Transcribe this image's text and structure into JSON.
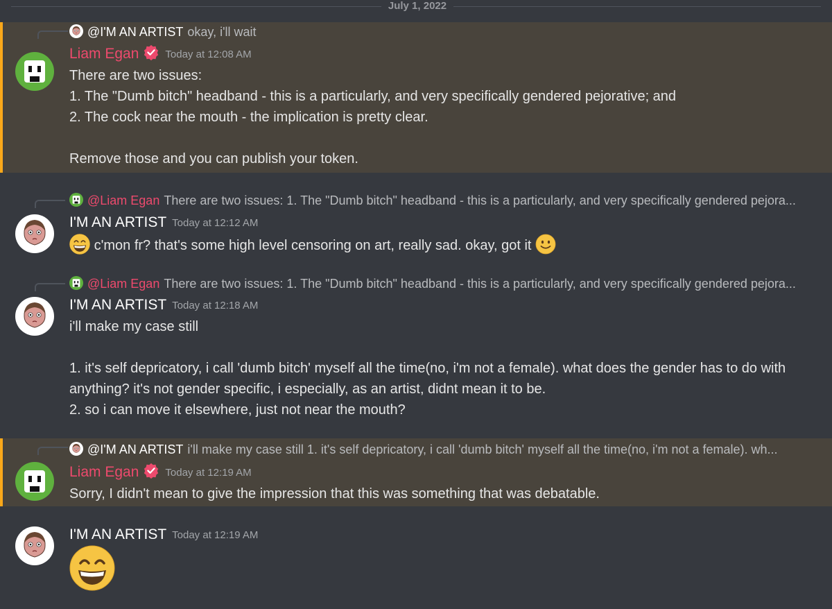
{
  "date_divider": "July 1, 2022",
  "messages": [
    {
      "reply": {
        "mention": "@I'M AN ARTIST",
        "preview": "okay, i'll wait"
      },
      "author": "Liam Egan",
      "timestamp": "Today at 12:08 AM",
      "lines": [
        "There are two issues:",
        "1. The \"Dumb bitch\" headband - this is a particularly, and very specifically gendered pejorative; and",
        "2. The cock near the mouth - the implication is pretty clear.",
        "",
        "Remove those and you can publish your token."
      ]
    },
    {
      "reply": {
        "mention": "@Liam Egan",
        "preview": "There are two issues: 1. The \"Dumb bitch\" headband - this is a particularly, and very specifically gendered pejora..."
      },
      "author": "I'M AN ARTIST",
      "timestamp": "Today at 12:12 AM",
      "text": "c'mon fr? that's some high level censoring on art, really sad. okay, got it"
    },
    {
      "reply": {
        "mention": "@Liam Egan",
        "preview": "There are two issues: 1. The \"Dumb bitch\" headband - this is a particularly, and very specifically gendered pejora..."
      },
      "author": "I'M AN ARTIST",
      "timestamp": "Today at 12:18 AM",
      "lines": [
        "i'll make my case still",
        "",
        "1. it's self depricatory, i call 'dumb bitch' myself all the time(no, i'm not a female). what does the gender has to do with anything? it's not gender specific, i especially, as an artist, didnt mean it to be.",
        "2. so i can move it elsewhere, just not near the mouth?"
      ]
    },
    {
      "reply": {
        "mention": "@I'M AN ARTIST",
        "preview": "i'll make my case still  1. it's self depricatory, i call 'dumb bitch' myself all the time(no, i'm not a female). wh..."
      },
      "author": "Liam Egan",
      "timestamp": "Today at 12:19 AM",
      "text": "Sorry, I didn't mean to give the impression that this was something that was debatable."
    },
    {
      "author": "I'M AN ARTIST",
      "timestamp": "Today at 12:19 AM",
      "emoji": "grinning-face"
    }
  ],
  "avatar_caption": "I AM AN ARTIST",
  "colors": {
    "background": "#36393f",
    "highlight_background": "#49443c",
    "highlight_border": "#faa81a",
    "mod_name": "#ed4a6d",
    "liam_avatar_bg": "#5fb13e"
  },
  "icons": {
    "verified_badge": "verified-badge-icon",
    "emoji_grin": "grinning-emoji",
    "emoji_smile": "slightly-smiling-emoji"
  }
}
